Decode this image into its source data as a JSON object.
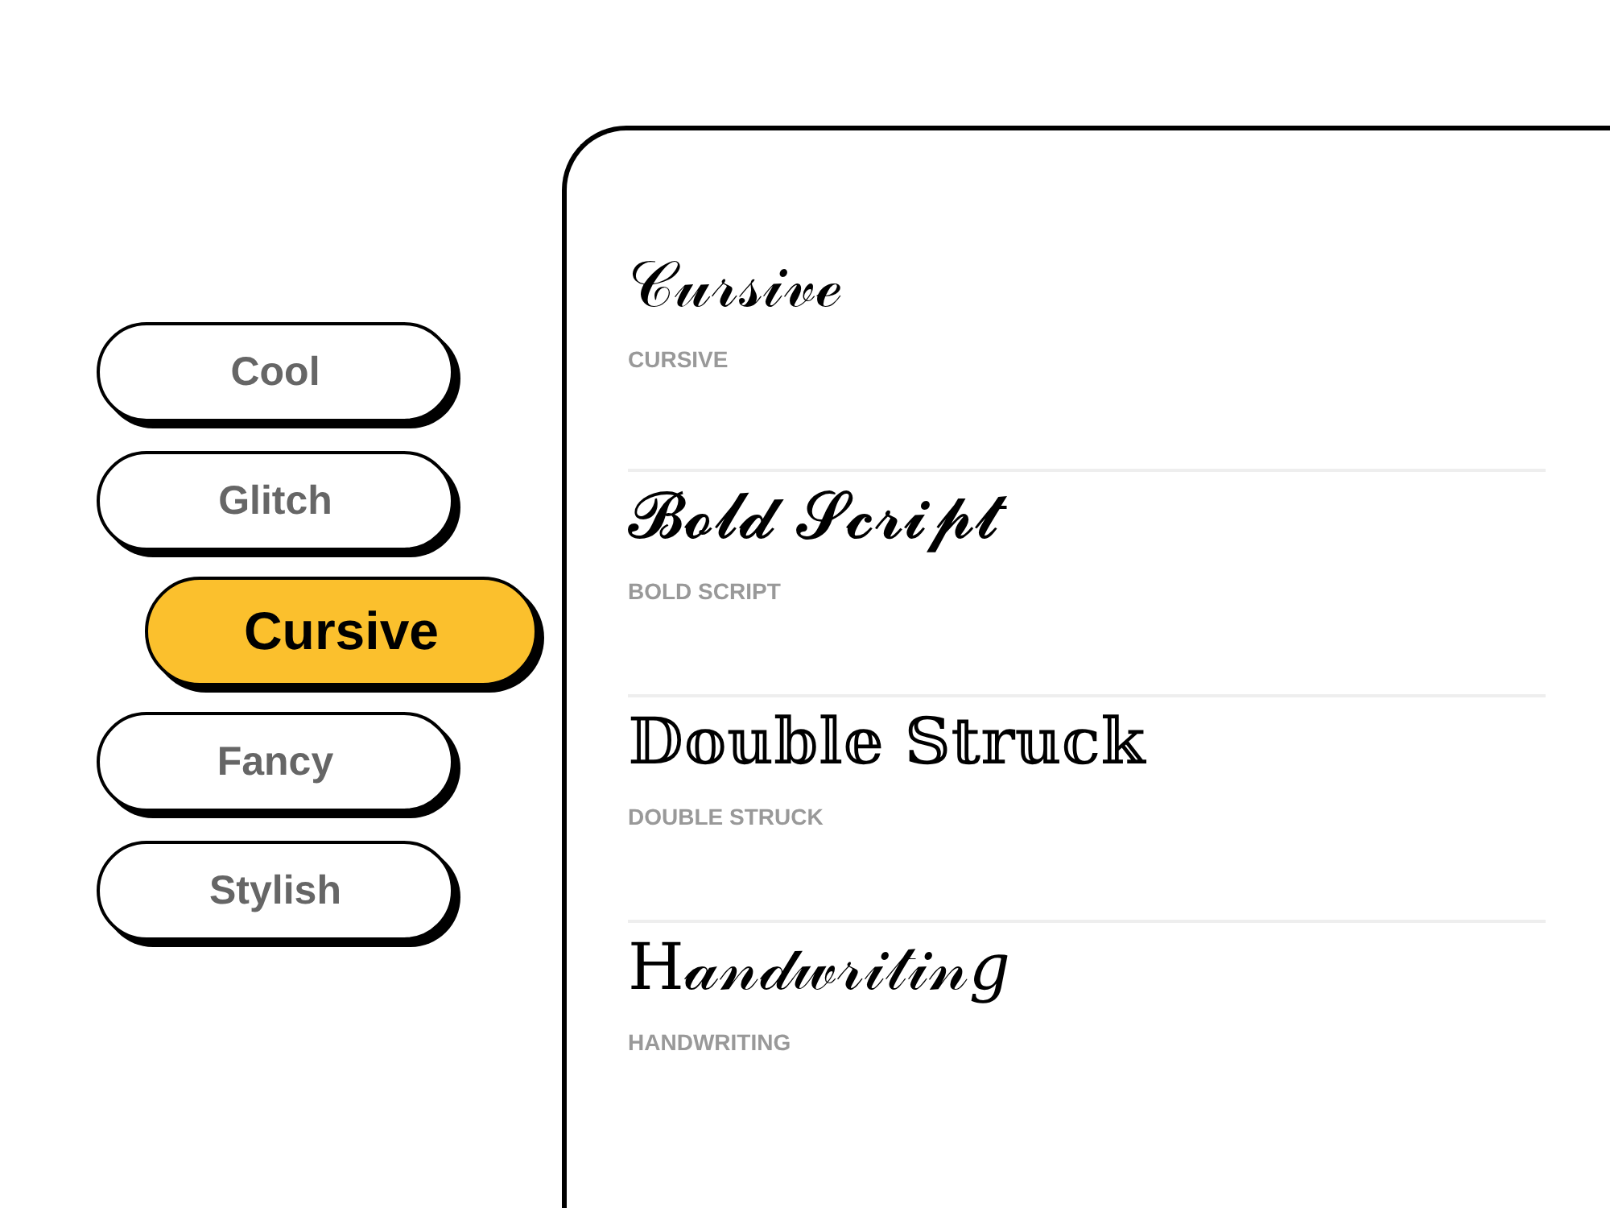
{
  "tabs": [
    {
      "label": "Cool",
      "selected": false
    },
    {
      "label": "Glitch",
      "selected": false
    },
    {
      "label": "Cursive",
      "selected": true
    },
    {
      "label": "Fancy",
      "selected": false
    },
    {
      "label": "Stylish",
      "selected": false
    }
  ],
  "styles": [
    {
      "sample": "𝒞𝓊𝓇𝓈𝒾𝓋ℯ",
      "name": "CURSIVE"
    },
    {
      "sample": "𝓑𝓸𝓵𝓭 𝓢𝓬𝓻𝓲𝓹𝓽",
      "name": "BOLD SCRIPT"
    },
    {
      "sample": "𝔻𝕠𝕦𝕓𝕝𝕖 𝕊𝕥𝕣𝕦𝕔𝕜",
      "name": "DOUBLE STRUCK"
    },
    {
      "sample": "H𝒶𝓃𝒹𝓌𝓇𝒾𝓉𝒾𝓃𝑔",
      "name": "HANDWRITING"
    }
  ]
}
